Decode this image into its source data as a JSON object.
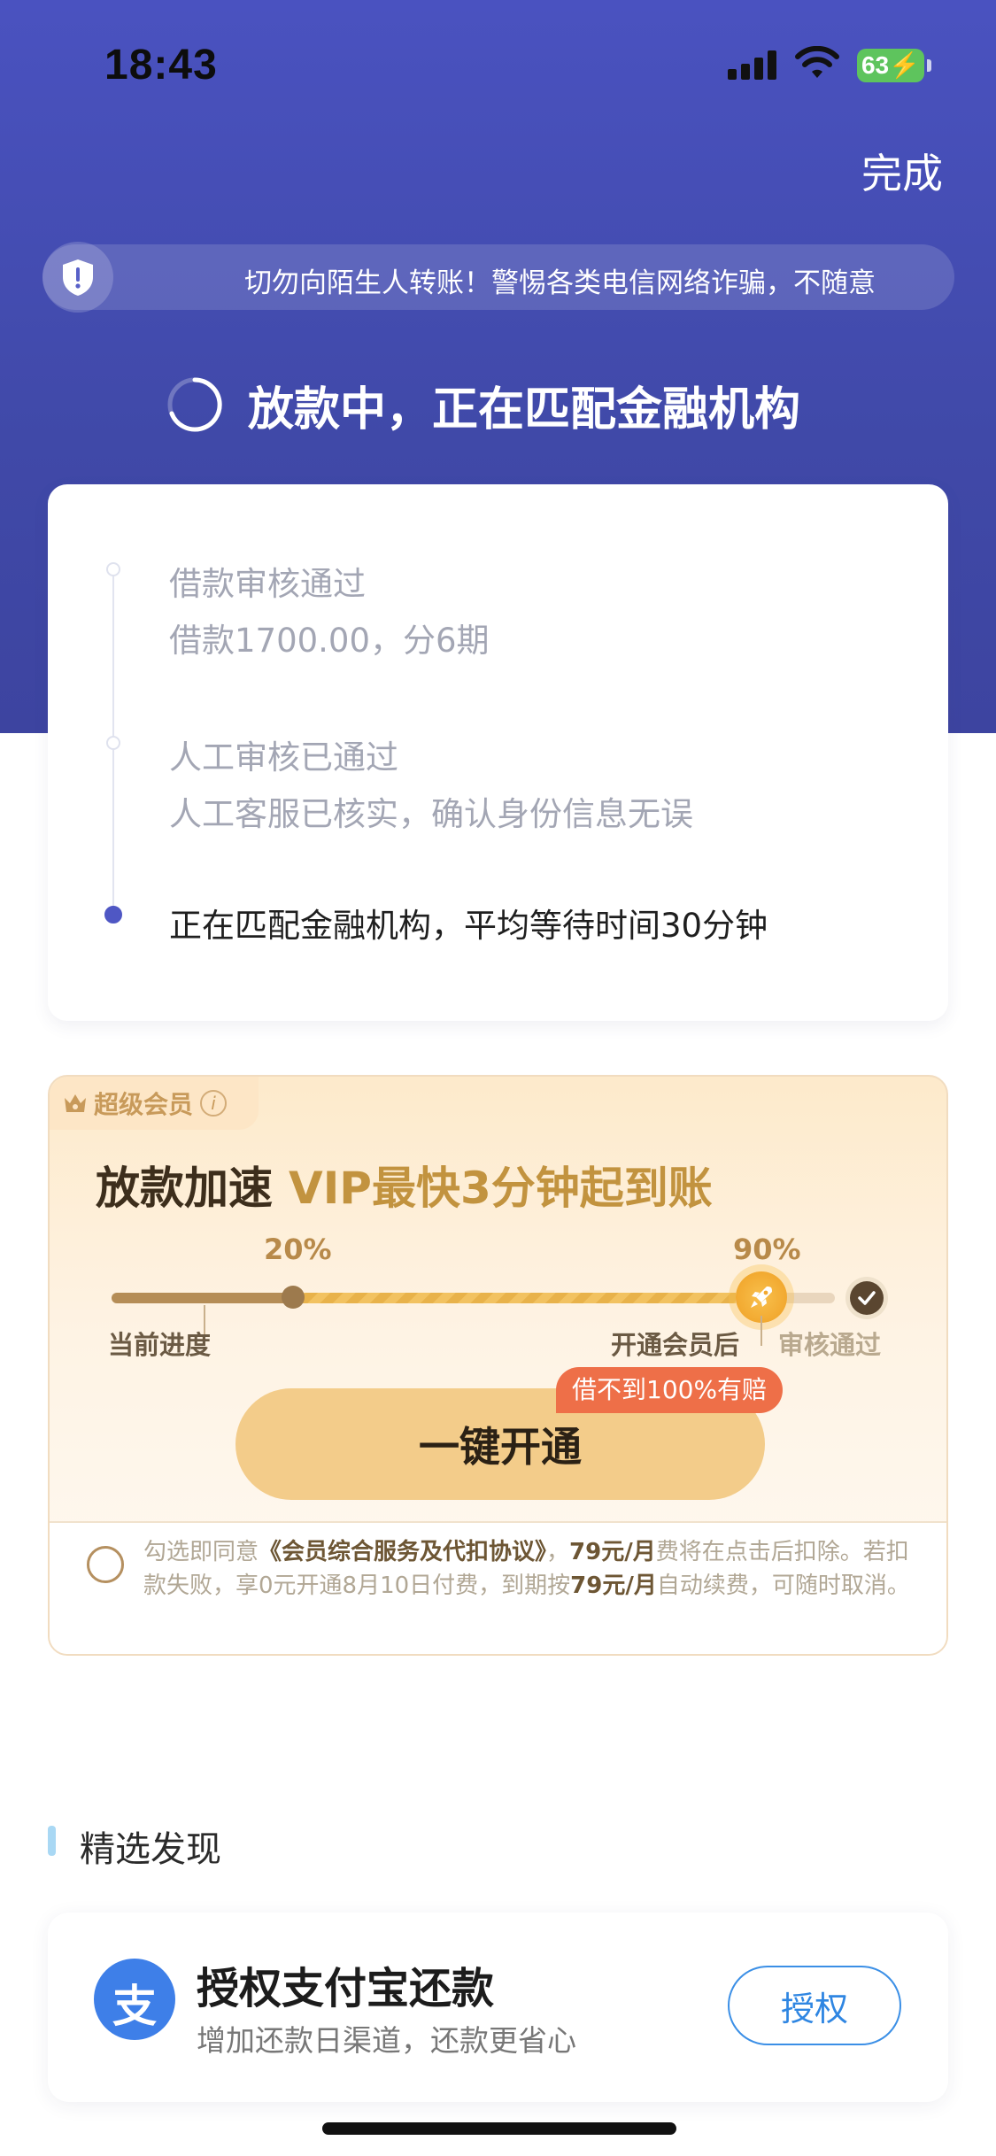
{
  "status_bar": {
    "time": "18:43",
    "battery": "63"
  },
  "nav": {
    "done_label": "完成"
  },
  "notice": {
    "text": "切勿向陌生人转账！警惕各类电信网络诈骗，不随意"
  },
  "status": {
    "heading": "放款中，正在匹配金融机构"
  },
  "progress_card": {
    "steps": [
      {
        "title": "借款审核通过",
        "subtitle": "借款1700.00，分6期"
      },
      {
        "title": "人工审核已通过",
        "subtitle": "人工客服已核实，确认身份信息无误"
      },
      {
        "title": "正在匹配金融机构，平均等待时间30分钟"
      }
    ]
  },
  "vip": {
    "tag": "超级会员",
    "tag_info": "i",
    "title": "放款加速",
    "title_accent": "VIP最快3分钟起到账",
    "current_pct": "20%",
    "after_pct": "90%",
    "current_progress": 0.2,
    "after_progress": 0.9,
    "label_current": "当前进度",
    "label_after": "开通会员后",
    "label_approved": "审核通过",
    "promise_badge": "借不到100%有赔",
    "open_button": "一键开通",
    "agreement": {
      "p1": "勾选即同意",
      "link": "《会员综合服务及代扣协议》",
      "p2": "，",
      "price1": "79元/月",
      "p3": "费将在点击后扣除。若扣款失败，享0元开通8月10日付费，到期按",
      "price2": "79元/月",
      "p4": "自动续费，可随时取消。"
    }
  },
  "discover": {
    "section_title": "精选发现",
    "card": {
      "icon_glyph": "支",
      "title": "授权支付宝还款",
      "subtitle": "增加还款日渠道，还款更省心",
      "button": "授权"
    }
  },
  "colors": {
    "hero": "#4a52c0",
    "vip_accent": "#c2933f",
    "open_button": "#f3cc8a",
    "promise_badge": "#ee6f48",
    "alipay_blue": "#3e7fe8"
  }
}
